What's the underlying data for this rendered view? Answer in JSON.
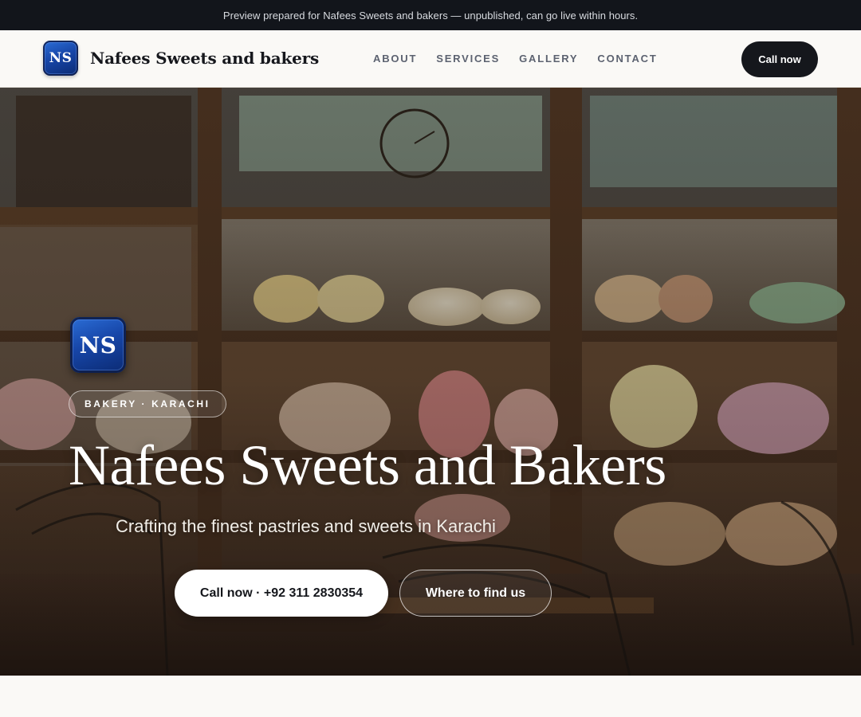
{
  "preview_banner": {
    "text": "Preview prepared for Nafees Sweets and bakers — unpublished, can go live within hours."
  },
  "header": {
    "logo_text": "NS",
    "brand_name": "Nafees Sweets and bakers",
    "nav": [
      {
        "label": "ABOUT"
      },
      {
        "label": "SERVICES"
      },
      {
        "label": "GALLERY"
      },
      {
        "label": "CONTACT"
      }
    ],
    "cta_label": "Call now"
  },
  "hero": {
    "logo_text": "NS",
    "tag": "BAKERY · KARACHI",
    "title": "Nafees Sweets and Bakers",
    "subtitle": "Crafting the finest pastries and sweets in Karachi",
    "call_button": "Call now · +92 311 2830354",
    "find_button": "Where to find us"
  },
  "colors": {
    "banner_bg": "#12151b",
    "header_bg": "#faf9f6",
    "cta_bg": "#15171c",
    "logo_blue": "#1746a8"
  }
}
